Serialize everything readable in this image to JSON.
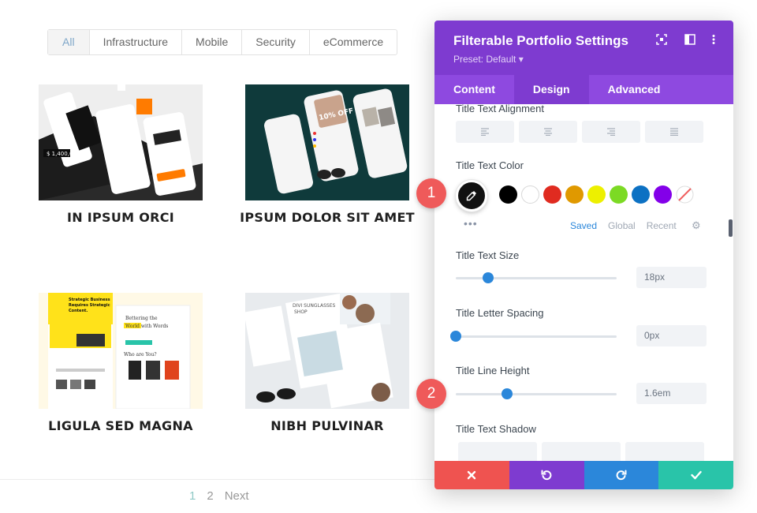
{
  "filters": [
    "All",
    "Infrastructure",
    "Mobile",
    "Security",
    "eCommerce"
  ],
  "portfolio": [
    {
      "title": "IN IPSUM ORCI"
    },
    {
      "title": "IPSUM DOLOR SIT AMET"
    },
    {
      "title": "LIGULA SED MAGNA"
    },
    {
      "title": "NIBH PULVINAR"
    }
  ],
  "pagination": {
    "pages": [
      "1",
      "2"
    ],
    "current": "1",
    "next_label": "Next"
  },
  "panel": {
    "title": "Filterable Portfolio Settings",
    "preset": "Preset: Default ▾",
    "tabs": [
      "Content",
      "Design",
      "Advanced"
    ],
    "active_tab": "Design",
    "fields": {
      "alignment_label": "Title Text Alignment",
      "color_label": "Title Text Color",
      "size_label": "Title Text Size",
      "size_value": "18px",
      "spacing_label": "Title Letter Spacing",
      "spacing_value": "0px",
      "line_height_label": "Title Line Height",
      "line_height_value": "1.6em",
      "shadow_label": "Title Text Shadow"
    },
    "slider_levels": {
      "size": 0.2,
      "spacing": 0.0,
      "line_height": 0.32
    },
    "color_tabs": [
      "Saved",
      "Global",
      "Recent"
    ],
    "active_color_tab": "Saved",
    "swatch_colors": [
      "#000000",
      "#ffffff",
      "#e02b20",
      "#e09900",
      "#edf000",
      "#7cda24",
      "#0c71c3",
      "#8300e9"
    ]
  },
  "badges": [
    "1",
    "2"
  ],
  "icons": {
    "picker": "eyedropper-icon",
    "footer": [
      "close-icon",
      "undo-icon",
      "redo-icon",
      "check-icon"
    ]
  }
}
